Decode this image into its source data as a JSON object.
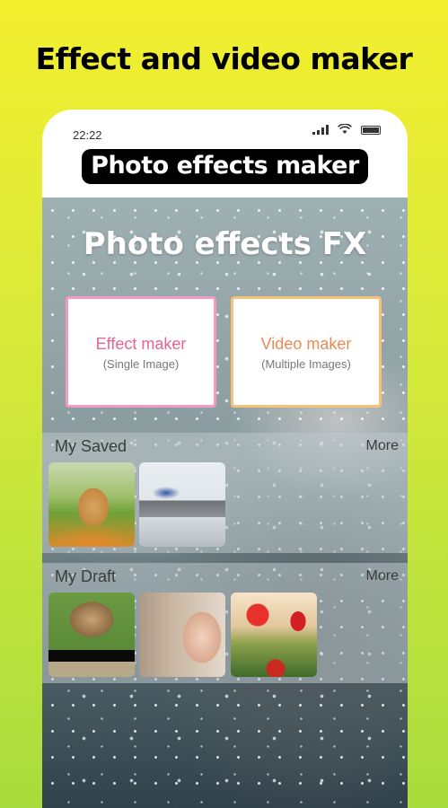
{
  "headline": "Effect and video maker",
  "status": {
    "time": "22:22"
  },
  "sticker": "Photo effects maker",
  "app": {
    "title": "Photo effects FX",
    "cards": {
      "effect": {
        "title": "Effect maker",
        "subtitle": "(Single Image)"
      },
      "video": {
        "title": "Video maker",
        "subtitle": "(Multiple Images)"
      }
    },
    "saved": {
      "title": "My Saved",
      "more": "More"
    },
    "draft": {
      "title": "My Draft",
      "more": "More"
    }
  },
  "colors": {
    "effect_border": "#f39ac4",
    "video_border": "#f6c27a",
    "effect_text": "#e8638f",
    "video_text": "#ec8a56"
  }
}
